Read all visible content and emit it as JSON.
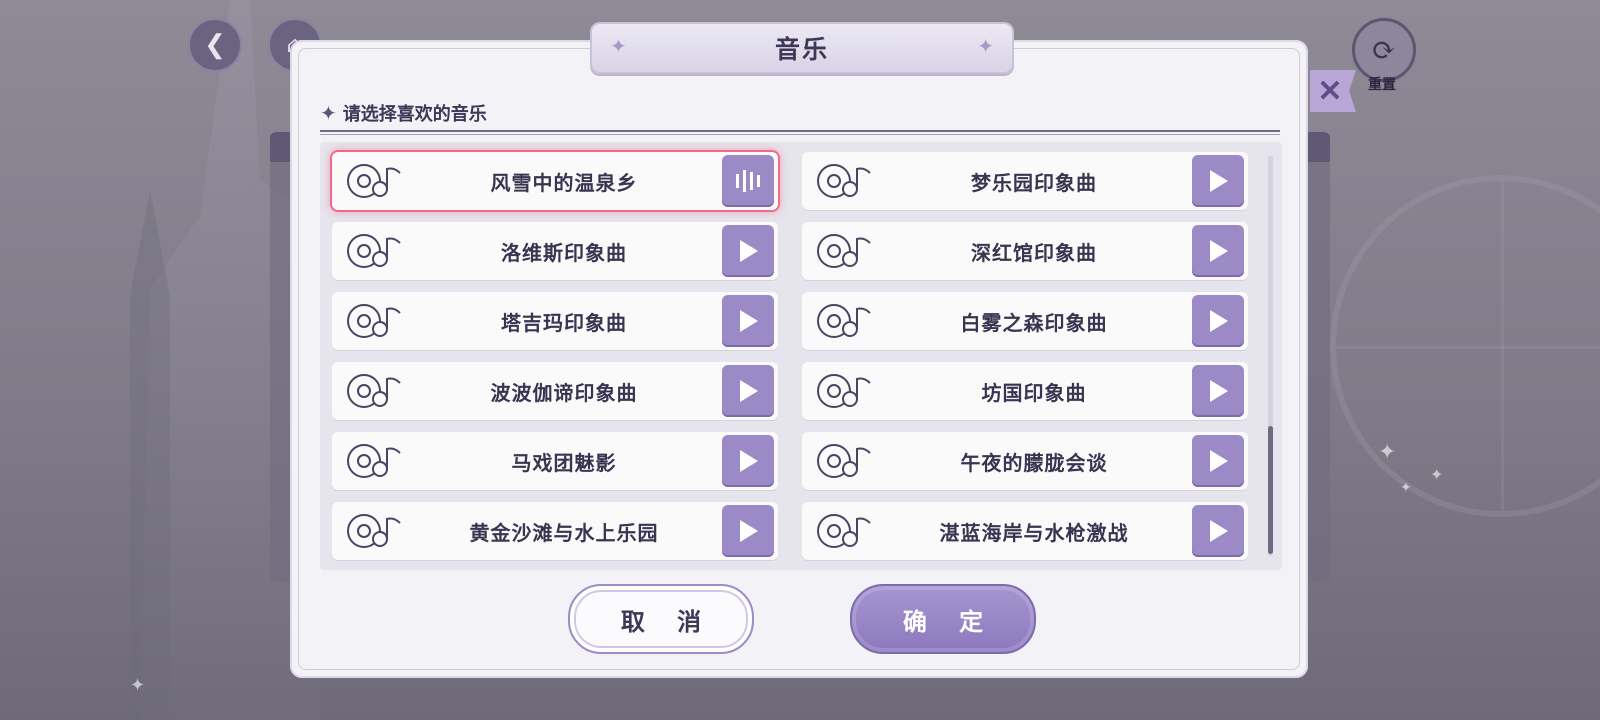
{
  "dialog": {
    "title": "音乐",
    "prompt": "请选择喜欢的音乐",
    "cancel_label": "取 消",
    "confirm_label": "确 定"
  },
  "header": {
    "reset_label": "重置"
  },
  "tracks": [
    {
      "name": "风雪中的温泉乡",
      "selected": true,
      "state": "playing"
    },
    {
      "name": "梦乐园印象曲",
      "selected": false,
      "state": "play"
    },
    {
      "name": "洛维斯印象曲",
      "selected": false,
      "state": "play"
    },
    {
      "name": "深红馆印象曲",
      "selected": false,
      "state": "play"
    },
    {
      "name": "塔吉玛印象曲",
      "selected": false,
      "state": "play"
    },
    {
      "name": "白雾之森印象曲",
      "selected": false,
      "state": "play"
    },
    {
      "name": "波波伽谛印象曲",
      "selected": false,
      "state": "play"
    },
    {
      "name": "坊国印象曲",
      "selected": false,
      "state": "play"
    },
    {
      "name": "马戏团魅影",
      "selected": false,
      "state": "play"
    },
    {
      "name": "午夜的朦胧会谈",
      "selected": false,
      "state": "play"
    },
    {
      "name": "黄金沙滩与水上乐园",
      "selected": false,
      "state": "play"
    },
    {
      "name": "湛蓝海岸与水枪激战",
      "selected": false,
      "state": "play"
    }
  ],
  "icons": {
    "disc": "music-disc-icon",
    "play": "play-icon",
    "playing": "sound-wave-icon",
    "back": "back-arrow-icon",
    "home": "home-icon",
    "reset": "refresh-icon",
    "close": "close-icon"
  },
  "colors": {
    "accent": "#9b8ac6",
    "selected_border": "#f06b8a",
    "text": "#3a3450"
  },
  "scrollbar": {
    "position_fraction": 0.7
  }
}
